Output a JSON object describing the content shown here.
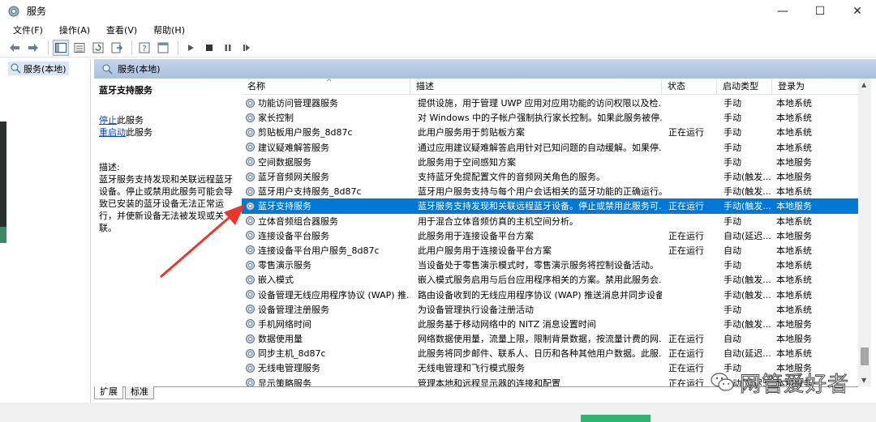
{
  "window": {
    "title": "服务",
    "minimize_glyph": "—",
    "maximize_glyph": "☐",
    "close_glyph": "✕"
  },
  "menu": [
    "文件(F)",
    "操作(A)",
    "查看(V)",
    "帮助(H)"
  ],
  "tree": {
    "root_label": "服务(本地)"
  },
  "main_header": {
    "label": "服务(本地)"
  },
  "detail": {
    "service_title": "蓝牙支持服务",
    "stop_link": "停止",
    "stop_suffix": "此服务",
    "restart_link": "重启动",
    "restart_suffix": "此服务",
    "desc_label": "描述:",
    "desc_text": "蓝牙服务支持发现和关联远程蓝牙设备。停止或禁用此服务可能会导致已安装的蓝牙设备无法正常运行，并使新设备无法被发现或关联。"
  },
  "table": {
    "columns": [
      "名称",
      "描述",
      "状态",
      "启动类型",
      "登录为"
    ],
    "rows": [
      {
        "name": "功能访问管理器服务",
        "desc": "提供设施，用于管理 UWP 应用对应用功能的访问权限以及检...",
        "status": "",
        "start": "手动",
        "logon": "本地系统"
      },
      {
        "name": "家长控制",
        "desc": "对 Windows 中的子帐户强制执行家长控制。如果此服务被停...",
        "status": "",
        "start": "手动",
        "logon": "本地系统"
      },
      {
        "name": "剪贴板用户服务_8d87c",
        "desc": "此用户服务用于剪贴板方案",
        "status": "正在运行",
        "start": "手动",
        "logon": "本地系统"
      },
      {
        "name": "建议疑难解答服务",
        "desc": "通过应用建议疑难解答启用针对已知问题的自动缓解。如果停...",
        "status": "",
        "start": "手动",
        "logon": "本地系统"
      },
      {
        "name": "空间数据服务",
        "desc": "此服务用于空间感知方案",
        "status": "",
        "start": "手动",
        "logon": "本地服务"
      },
      {
        "name": "蓝牙音频网关服务",
        "desc": "支持蓝牙免提配置文件的音频网关角色的服务。",
        "status": "",
        "start": "手动(触发...",
        "logon": "本地服务"
      },
      {
        "name": "蓝牙用户支持服务_8d87c",
        "desc": "蓝牙用户服务支持与每个用户会话相关的蓝牙功能的正确运行。",
        "status": "",
        "start": "手动(触发...",
        "logon": "本地系统"
      },
      {
        "name": "蓝牙支持服务",
        "desc": "蓝牙服务支持发现和关联远程蓝牙设备。停止或禁用此服务可...",
        "status": "正在运行",
        "start": "手动(触发...",
        "logon": "本地服务",
        "selected": true
      },
      {
        "name": "立体音频组合器服务",
        "desc": "用于混合立体音频仿真的主机空间分析。",
        "status": "",
        "start": "手动",
        "logon": "本地系统"
      },
      {
        "name": "连接设备平台服务",
        "desc": "此服务用于连接设备平台方案",
        "status": "正在运行",
        "start": "自动(延迟...",
        "logon": "本地服务"
      },
      {
        "name": "连接设备平台用户服务_8d87c",
        "desc": "此用户服务用于连接设备平台方案",
        "status": "正在运行",
        "start": "自动",
        "logon": "本地系统"
      },
      {
        "name": "零售演示服务",
        "desc": "当设备处于零售演示模式时，零售演示服务将控制设备活动。",
        "status": "",
        "start": "手动",
        "logon": "本地系统"
      },
      {
        "name": "嵌入模式",
        "desc": "嵌入模式服务启用与后台应用程序相关的方案。禁用此服务会...",
        "status": "",
        "start": "手动(触发...",
        "logon": "本地系统"
      },
      {
        "name": "设备管理无线应用程序协议 (WAP) 推...",
        "desc": "路由设备收到的无线应用程序协议 (WAP) 推送消息并同步设备...",
        "status": "",
        "start": "手动(触发...",
        "logon": "本地系统"
      },
      {
        "name": "设备管理注册服务",
        "desc": "为设备管理执行设备注册活动",
        "status": "",
        "start": "手动",
        "logon": "本地系统"
      },
      {
        "name": "手机网络时间",
        "desc": "此服务基于移动网络中的 NITZ 消息设置时间",
        "status": "",
        "start": "手动(触发...",
        "logon": "本地服务"
      },
      {
        "name": "数据使用量",
        "desc": "网络数据使用量，流量上限，限制背景数据，按流量计费的网...",
        "status": "正在运行",
        "start": "自动",
        "logon": "本地服务"
      },
      {
        "name": "同步主机_8d87c",
        "desc": "此服务将同步邮件、联系人、日历和各种其他用户数据。此服...",
        "status": "正在运行",
        "start": "自动(延迟...",
        "logon": "本地系统"
      },
      {
        "name": "无线电管理服务",
        "desc": "无线电管理和飞行模式服务",
        "status": "正在运行",
        "start": "手动",
        "logon": "本地服务"
      },
      {
        "name": "显示策略服务",
        "desc": "管理本地和远程显示器的连接和配置",
        "status": "正在运行",
        "start": "自动(延迟...",
        "logon": "本地服务"
      }
    ]
  },
  "tabs": [
    "扩展",
    "标准"
  ],
  "watermark": {
    "text": "网管爱好者"
  }
}
